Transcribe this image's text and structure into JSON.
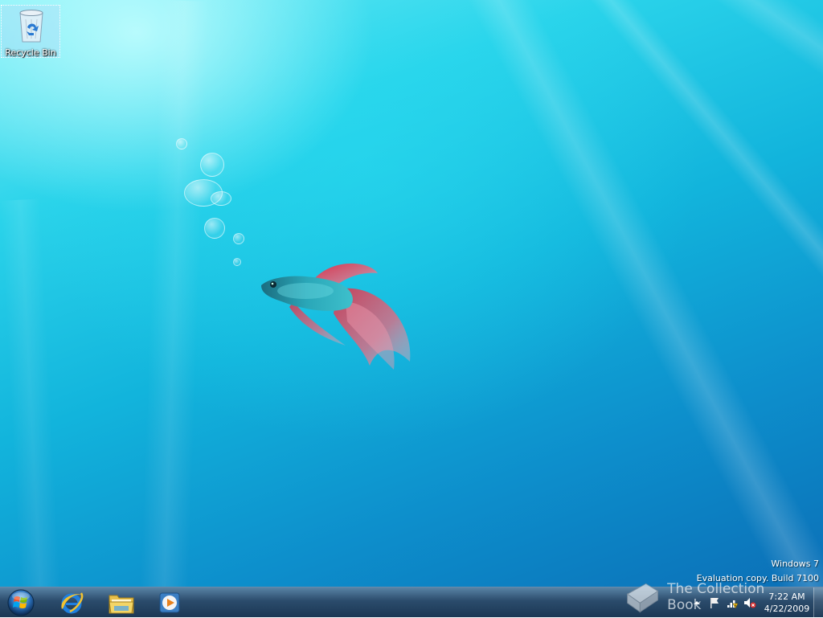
{
  "desktop": {
    "icons": [
      {
        "label": "Recycle Bin",
        "icon": "recycle-bin-icon"
      }
    ],
    "watermark": {
      "line1": "Windows 7",
      "line2": "Evaluation copy. Build 7100"
    }
  },
  "taskbar": {
    "start": {
      "icon": "windows-start-orb-icon"
    },
    "pinned": [
      {
        "icon": "internet-explorer-icon"
      },
      {
        "icon": "windows-explorer-icon"
      },
      {
        "icon": "windows-media-player-icon"
      }
    ],
    "tray": {
      "icons": [
        "show-hidden-icons-arrow",
        "action-center-flag-icon",
        "network-icon",
        "volume-muted-icon"
      ],
      "time": "7:22 AM",
      "date": "4/22/2009"
    }
  },
  "overlay": {
    "logo_text": "The Collection Book"
  },
  "colors": {
    "water_light": "#7ff0f7",
    "water_mid": "#12b4dc",
    "water_deep": "#0b6fb7",
    "taskbar": "#1e4a73"
  }
}
